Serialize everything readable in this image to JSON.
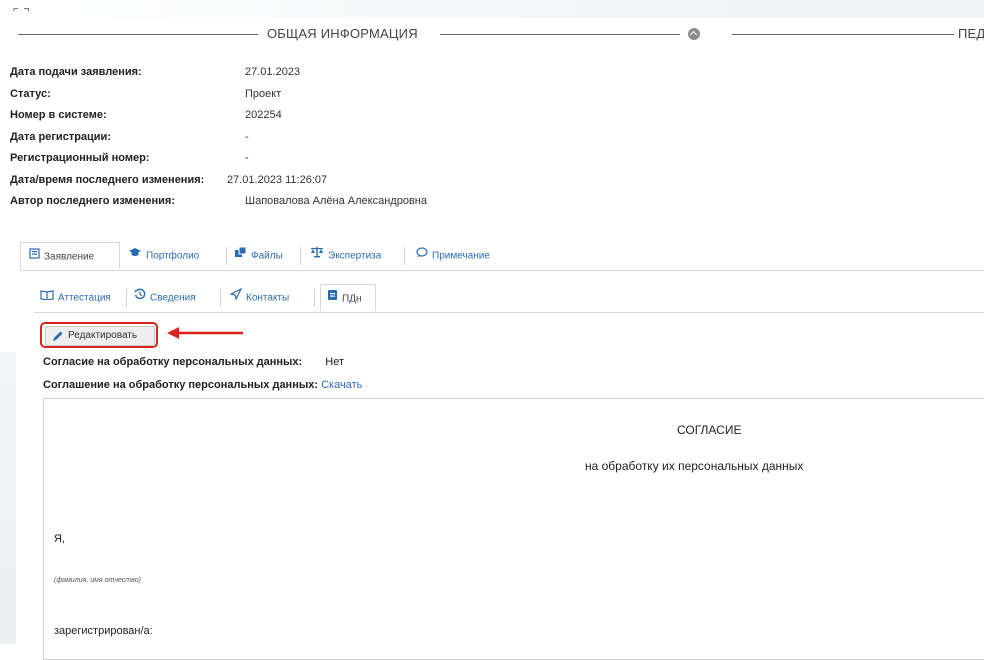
{
  "corner_mark": "⌐ ¬",
  "section": {
    "title": "ОБЩАЯ ИНФОРМАЦИЯ",
    "right_title": "ПЕД"
  },
  "info": [
    {
      "label": "Дата подачи заявления:",
      "value": "27.01.2023"
    },
    {
      "label": "Статус:",
      "value": "Проект"
    },
    {
      "label": "Номер в системе:",
      "value": "202254"
    },
    {
      "label": "Дата регистрации:",
      "value": "-"
    },
    {
      "label": "Регистрационный номер:",
      "value": "-"
    },
    {
      "label": "Дата/время последнего изменения:",
      "value": "27.01.2023 11:26:07"
    },
    {
      "label": "Автор последнего изменения:",
      "value": "Шаповалова Алёна Александровна"
    }
  ],
  "tabs_main": [
    {
      "label": "Заявление",
      "icon": "document-icon"
    },
    {
      "label": "Портфолио",
      "icon": "graduation-cap-icon"
    },
    {
      "label": "Файлы",
      "icon": "files-icon"
    },
    {
      "label": "Экспертиза",
      "icon": "scales-icon"
    },
    {
      "label": "Примечание",
      "icon": "comment-icon"
    }
  ],
  "tabs_sub": [
    {
      "label": "Аттестация",
      "icon": "book-icon"
    },
    {
      "label": "Сведения",
      "icon": "history-icon"
    },
    {
      "label": "Контакты",
      "icon": "send-icon"
    },
    {
      "label": "ПДн",
      "icon": "id-card-icon"
    }
  ],
  "edit_button": "Редактировать",
  "consent": {
    "agree_label": "Согласие на обработку персональных данных:",
    "agree_value": "Нет",
    "agreement_label": "Соглашение на обработку персональных данных:",
    "agreement_link": "Скачать"
  },
  "document": {
    "title": "СОГЛАСИЕ",
    "subtitle": "на обработку их персональных данных",
    "i_label": "Я,",
    "fio_hint": "(фамилия, имя отчество)",
    "registered": "зарегистрирован/а:"
  },
  "colors": {
    "link": "#2b6cb0",
    "highlight": "#d9261c"
  }
}
